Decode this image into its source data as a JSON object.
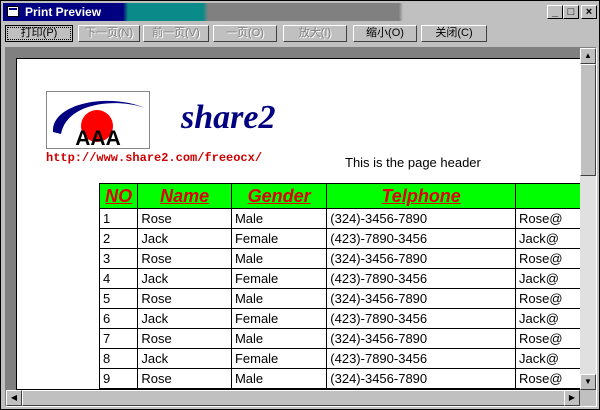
{
  "window": {
    "title": "Print Preview",
    "controls": [
      "_",
      "□",
      "×"
    ]
  },
  "toolbar": {
    "buttons": [
      {
        "label": "打印(P)",
        "enabled": true
      },
      {
        "label": "下一页(N)",
        "enabled": false
      },
      {
        "label": "前一页(V)",
        "enabled": false
      },
      {
        "label": "一页(O)",
        "enabled": false
      },
      {
        "label": "放大(I)",
        "enabled": false
      },
      {
        "label": "缩小(O)",
        "enabled": true
      },
      {
        "label": "关闭(C)",
        "enabled": true
      }
    ]
  },
  "page": {
    "logo_text": "AAA",
    "brand": "share2",
    "url": "http://www.share2.com/freeocx/",
    "header_text": "This is the page header",
    "table": {
      "columns": [
        "NO",
        "Name",
        "Gender",
        "Telphone",
        ""
      ],
      "rows": [
        [
          "1",
          "Rose",
          "Male",
          "(324)-3456-7890",
          "Rose@"
        ],
        [
          "2",
          "Jack",
          "Female",
          "(423)-7890-3456",
          "Jack@"
        ],
        [
          "3",
          "Rose",
          "Male",
          "(324)-3456-7890",
          "Rose@"
        ],
        [
          "4",
          "Jack",
          "Female",
          "(423)-7890-3456",
          "Jack@"
        ],
        [
          "5",
          "Rose",
          "Male",
          "(324)-3456-7890",
          "Rose@"
        ],
        [
          "6",
          "Jack",
          "Female",
          "(423)-7890-3456",
          "Jack@"
        ],
        [
          "7",
          "Rose",
          "Male",
          "(324)-3456-7890",
          "Rose@"
        ],
        [
          "8",
          "Jack",
          "Female",
          "(423)-7890-3456",
          "Jack@"
        ],
        [
          "9",
          "Rose",
          "Male",
          "(324)-3456-7890",
          "Rose@"
        ]
      ]
    }
  },
  "scrollbars": {
    "up": "▲",
    "down": "▼",
    "left": "◀",
    "right": "▶"
  },
  "colors": {
    "accent": "#000080",
    "table_header_bg": "#00ff00",
    "table_header_text": "#e00000",
    "url": "#cc0000"
  }
}
